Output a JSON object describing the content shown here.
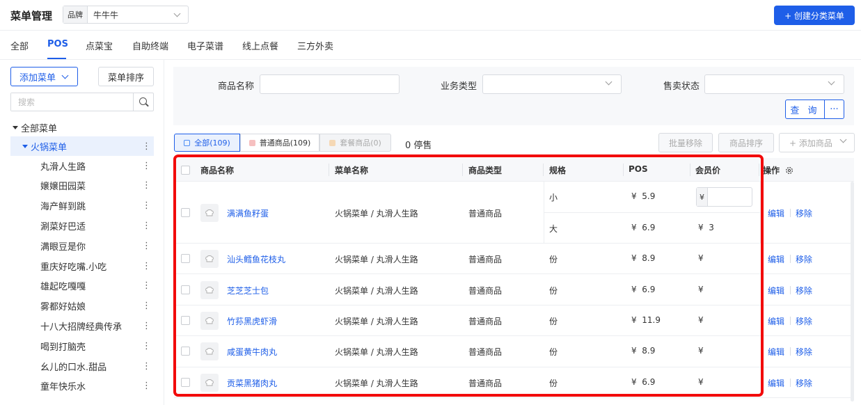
{
  "header": {
    "title": "菜单管理",
    "brand_label": "品牌",
    "brand_value": "牛牛牛",
    "create_button": "+ 创建分类菜单"
  },
  "tabs": [
    {
      "label": "全部"
    },
    {
      "label": "POS",
      "active": true
    },
    {
      "label": "点菜宝"
    },
    {
      "label": "自助终端"
    },
    {
      "label": "电子菜谱"
    },
    {
      "label": "线上点餐"
    },
    {
      "label": "三方外卖"
    }
  ],
  "sidebar": {
    "add_menu": "添加菜单",
    "sort_menu": "菜单排序",
    "search_placeholder": "搜索",
    "root": "全部菜单",
    "group": "火锅菜单",
    "items": [
      "丸滑人生路",
      "嬢嬢田园菜",
      "海产鲜到跳",
      "涮菜好巴适",
      "满眼豆是你",
      "重庆好吃嘴.小吃",
      "雄起吃嘎嘎",
      "雾都好姑娘",
      "十八大招牌经典传承",
      "喝到打脑壳",
      "幺儿的口水.甜品",
      "童年快乐水"
    ]
  },
  "filter": {
    "product_name_label": "商品名称",
    "business_type_label": "业务类型",
    "sale_status_label": "售卖状态",
    "query_button": "查 询",
    "more_button": "···"
  },
  "segments": {
    "all": "全部(109)",
    "normal": "普通商品(109)",
    "combo": "套餐商品(0)",
    "stopped": "0 停售"
  },
  "actions": {
    "batch_remove": "批量移除",
    "product_sort": "商品排序",
    "add_product": "+ 添加商品"
  },
  "table": {
    "headers": {
      "name": "商品名称",
      "menu": "菜单名称",
      "type": "商品类型",
      "spec": "规格",
      "pos": "POS",
      "member": "会员价",
      "ops": "操作"
    },
    "currency": "¥",
    "edit": "编辑",
    "remove": "移除",
    "rows": [
      {
        "name": "满满鱼籽蛋",
        "menu": "火锅菜单 / 丸滑人生路",
        "type": "普通商品",
        "specs": [
          {
            "spec": "小",
            "pos": "5.9",
            "member": ""
          },
          {
            "spec": "大",
            "pos": "6.9",
            "member": "3"
          }
        ]
      },
      {
        "name": "汕头鳕鱼花枝丸",
        "menu": "火锅菜单 / 丸滑人生路",
        "type": "普通商品",
        "spec": "份",
        "pos": "8.9",
        "member": ""
      },
      {
        "name": "芝芝芝士包",
        "menu": "火锅菜单 / 丸滑人生路",
        "type": "普通商品",
        "spec": "份",
        "pos": "6.9",
        "member": ""
      },
      {
        "name": "竹荪黑虎虾滑",
        "menu": "火锅菜单 / 丸滑人生路",
        "type": "普通商品",
        "spec": "份",
        "pos": "11.9",
        "member": ""
      },
      {
        "name": "咸蛋黄牛肉丸",
        "menu": "火锅菜单 / 丸滑人生路",
        "type": "普通商品",
        "spec": "份",
        "pos": "8.9",
        "member": ""
      },
      {
        "name": "贡菜黑猪肉丸",
        "menu": "火锅菜单 / 丸滑人生路",
        "type": "普通商品",
        "spec": "份",
        "pos": "6.9",
        "member": ""
      }
    ]
  },
  "colors": {
    "accent": "#1e5ee8",
    "highlight": "#f20b0b"
  }
}
